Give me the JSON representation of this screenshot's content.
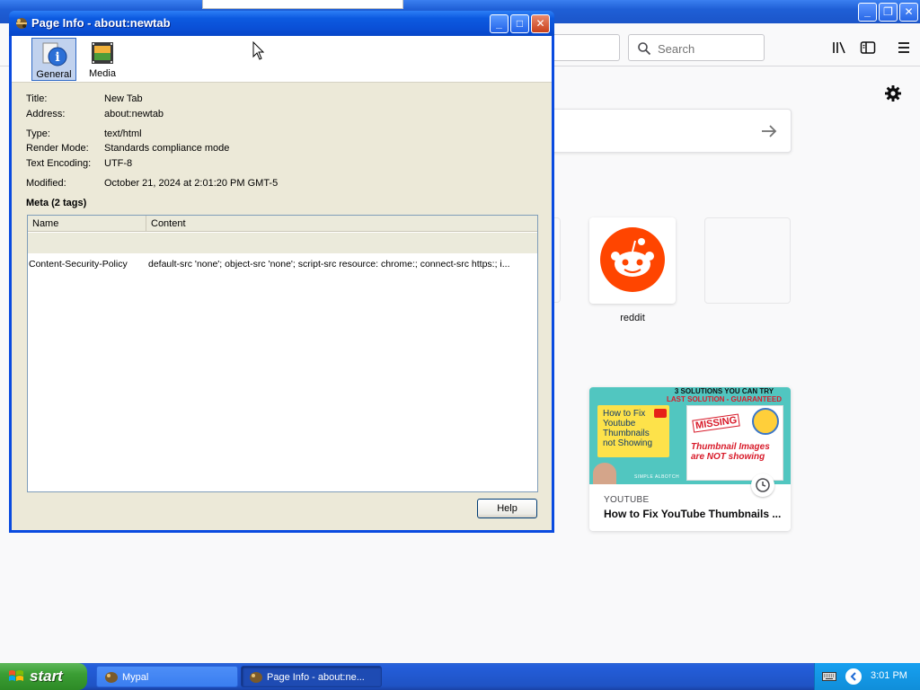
{
  "firefox": {
    "search_placeholder": "Search",
    "topsites": [
      {
        "label": "reddit"
      }
    ],
    "highlight": {
      "source": "YOUTUBE",
      "title": "How to Fix YouTube Thumbnails ...",
      "thumbnail": {
        "banner_top": "3 SOLUTIONS YOU CAN TRY",
        "banner_bottom": "LAST SOLUTION - GUARANTEED",
        "yellow_text": "How to Fix Youtube Thumbnails not Showing",
        "missing_label": "MISSING",
        "red_text": "Thumbnail Images are NOT showing",
        "caption": "SIMPLE ALBOTCH"
      }
    }
  },
  "dialog": {
    "title": "Page Info - about:newtab",
    "tabs": [
      {
        "label": "General",
        "selected": true
      },
      {
        "label": "Media",
        "selected": false
      }
    ],
    "fields": {
      "title_label": "Title:",
      "title_value": "New Tab",
      "address_label": "Address:",
      "address_value": "about:newtab",
      "type_label": "Type:",
      "type_value": "text/html",
      "render_label": "Render Mode:",
      "render_value": "Standards compliance mode",
      "encoding_label": "Text Encoding:",
      "encoding_value": "UTF-8",
      "modified_label": "Modified:",
      "modified_value": "October 21, 2024 at 2:01:20 PM GMT-5"
    },
    "meta": {
      "heading": "Meta (2 tags)",
      "columns": [
        "Name",
        "Content"
      ],
      "rows": [
        {
          "name": "Content-Security-Policy",
          "content": "default-src 'none'; object-src 'none'; script-src resource: chrome:; connect-src https:; i..."
        }
      ]
    },
    "help_label": "Help"
  },
  "taskbar": {
    "start_label": "start",
    "tasks": [
      {
        "label": "Mypal",
        "active": false
      },
      {
        "label": "Page Info - about:ne...",
        "active": true
      }
    ],
    "clock": "3:01 PM"
  },
  "colors": {
    "xp_blue": "#0a4be0",
    "dialog_face": "#ece9d8",
    "start_green": "#3b9e34",
    "reddit_orange": "#ff4500"
  }
}
